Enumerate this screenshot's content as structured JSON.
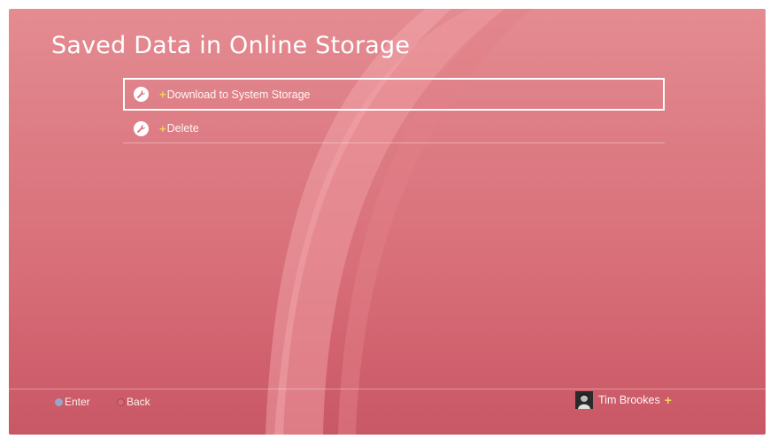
{
  "screen": {
    "title": "Saved Data in Online Storage"
  },
  "menu": {
    "items": [
      {
        "plus": "+",
        "label": "Download to System Storage",
        "icon": "wrench-icon",
        "selected": true
      },
      {
        "plus": "+",
        "label": "Delete",
        "icon": "wrench-icon",
        "selected": false
      }
    ]
  },
  "footer": {
    "enter_label": "Enter",
    "back_label": "Back",
    "user_name": "Tim Brookes",
    "user_plus": "+"
  },
  "colors": {
    "background": "#dd7c84",
    "plus_accent": "#f6d35c",
    "text": "#ffffff"
  }
}
